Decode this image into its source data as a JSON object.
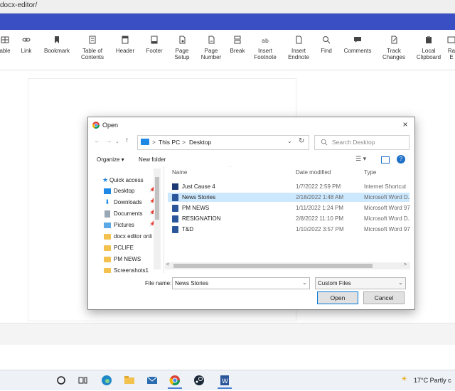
{
  "browser": {
    "url": "docx-editor/"
  },
  "toolbar": {
    "items": [
      {
        "label": "able"
      },
      {
        "label": "Link"
      },
      {
        "label": "Bookmark"
      },
      {
        "label": "Table of Contents"
      },
      {
        "label": "Header"
      },
      {
        "label": "Footer"
      },
      {
        "label": "Page Setup"
      },
      {
        "label": "Page Number"
      },
      {
        "label": "Break"
      },
      {
        "label": "Insert Footnote"
      },
      {
        "label": "Insert Endnote"
      },
      {
        "label": "Find"
      },
      {
        "label": "Comments"
      },
      {
        "label": "Track Changes"
      },
      {
        "label": "Local Clipboard"
      },
      {
        "label": "Ra E"
      }
    ]
  },
  "dialog": {
    "title": "Open",
    "close": "×",
    "address": {
      "seg1": "This PC",
      "sep": ">",
      "seg2": "Desktop"
    },
    "search_placeholder": "Search Desktop",
    "organize": "Organize ▾",
    "new_folder": "New folder",
    "nav": [
      {
        "label": "Quick access"
      },
      {
        "label": "Desktop"
      },
      {
        "label": "Downloads"
      },
      {
        "label": "Documents"
      },
      {
        "label": "Pictures"
      },
      {
        "label": "docx editor onli"
      },
      {
        "label": "PCLIFE"
      },
      {
        "label": "PM NEWS"
      },
      {
        "label": "Screenshots1"
      }
    ],
    "columns": {
      "name": "Name",
      "date": "Date modified",
      "type": "Type"
    },
    "files": [
      {
        "name": "Just Cause 4",
        "date": "1/7/2022 2:59 PM",
        "type": "Internet Shortcut"
      },
      {
        "name": "News Stories",
        "date": "2/18/2022 1:48 AM",
        "type": "Microsoft Word D..."
      },
      {
        "name": "PM NEWS",
        "date": "1/11/2022 1:24 PM",
        "type": "Microsoft Word 97..."
      },
      {
        "name": "RESIGNATION",
        "date": "2/8/2022 11:10 PM",
        "type": "Microsoft Word D..."
      },
      {
        "name": "T&D",
        "date": "1/10/2022 3:57 PM",
        "type": "Microsoft Word 97..."
      }
    ],
    "filename_label": "File name:",
    "filename_value": "News Stories",
    "filter": "Custom Files",
    "open_btn": "Open",
    "cancel_btn": "Cancel"
  },
  "taskbar": {
    "weather": "17°C  Partly c"
  },
  "colors": {
    "accent": "#3b4fc4",
    "selection": "#cce8ff"
  }
}
